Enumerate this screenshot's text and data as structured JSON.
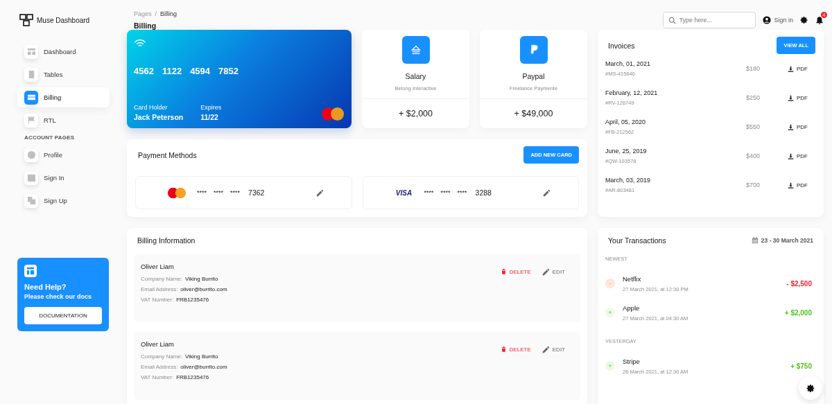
{
  "sidebar": {
    "brand": "Muse Dashboard",
    "items": [
      {
        "label": "Dashboard",
        "selected": false
      },
      {
        "label": "Tables",
        "selected": false
      },
      {
        "label": "Billing",
        "selected": true
      },
      {
        "label": "RTL",
        "selected": false
      }
    ],
    "section": "ACCOUNT PAGES",
    "account_items": [
      {
        "label": "Profile",
        "selected": false
      },
      {
        "label": "Sign In",
        "selected": false
      },
      {
        "label": "Sign Up",
        "selected": false
      }
    ],
    "help": {
      "title": "Need Help?",
      "subtitle": "Please check our docs",
      "button": "DOCUMENTATION"
    }
  },
  "header": {
    "breadcrumb": [
      "Pages",
      "Billing"
    ],
    "separator": "/",
    "title": "Billing",
    "search": {
      "placeholder": "Type here..."
    },
    "sign_in": "Sign in",
    "notifications": "4"
  },
  "credit_card": {
    "number": [
      "4562",
      "1122",
      "4594",
      "7852"
    ],
    "holder_label": "Card Holder",
    "holder": "Jack Peterson",
    "expires_label": "Expires",
    "expires": "11/22"
  },
  "income_cards": [
    {
      "kind": "salary",
      "title": "Salary",
      "subtitle": "Belong Interactive",
      "amount": "+ $2,000"
    },
    {
      "kind": "paypal",
      "title": "Paypal",
      "subtitle": "Freelance Paymente",
      "amount": "+ $49,000"
    }
  ],
  "payment_methods": {
    "title": "Payment Methods",
    "button": "ADD NEW CARD",
    "cards": [
      {
        "kind": "mastercard",
        "masked": [
          "****",
          "****",
          "****"
        ],
        "last4": "7362"
      },
      {
        "kind": "visa",
        "brand": "VISA",
        "masked": [
          "****",
          "****",
          "****"
        ],
        "last4": "3288"
      }
    ]
  },
  "invoices": {
    "title": "Invoices",
    "button": "VIEW ALL",
    "items": [
      {
        "date": "March, 01, 2021",
        "id": "#MS-415646",
        "amount": "$180",
        "action": "PDF"
      },
      {
        "date": "February, 12, 2021",
        "id": "#RV-126749",
        "amount": "$250",
        "action": "PDF"
      },
      {
        "date": "April, 05, 2020",
        "id": "#FB-212562",
        "amount": "$550",
        "action": "PDF"
      },
      {
        "date": "June, 25, 2019",
        "id": "#QW-103578",
        "amount": "$400",
        "action": "PDF"
      },
      {
        "date": "March, 03, 2019",
        "id": "#AR-803481",
        "amount": "$700",
        "action": "PDF"
      }
    ]
  },
  "billing": {
    "title": "Billing Information",
    "entries": [
      {
        "name": "Oliver Liam",
        "fields": [
          {
            "label": "Company Name:",
            "value": "Viking Burrito"
          },
          {
            "label": "Email Address:",
            "value": "oliver@burrito.com"
          },
          {
            "label": "VAT Number:",
            "value": "FRB1235476"
          }
        ],
        "delete": "DELETE",
        "edit": "EDIT"
      },
      {
        "name": "Oliver Liam",
        "fields": [
          {
            "label": "Company Name:",
            "value": "Viking Burrito"
          },
          {
            "label": "Email Address:",
            "value": "oliver@burrito.com"
          },
          {
            "label": "VAT Number:",
            "value": "FRB1235476"
          }
        ],
        "delete": "DELETE",
        "edit": "EDIT"
      }
    ]
  },
  "transactions": {
    "title": "Your Transactions",
    "date_range": "23 - 30 March 2021",
    "groups": [
      {
        "label": "NEWEST",
        "items": [
          {
            "kind": "debit",
            "sign": "-",
            "name": "Netflix",
            "time": "27 March 2021, at 12:30 PM",
            "amount": "- $2,500"
          },
          {
            "kind": "credit",
            "sign": "+",
            "name": "Apple",
            "time": "27 March 2021, at 04:30 AM",
            "amount": "+ $2,000"
          }
        ]
      },
      {
        "label": "YESTERDAY",
        "items": [
          {
            "kind": "credit",
            "sign": "+",
            "name": "Stripe",
            "time": "26 March 2021, at 12:30 AM",
            "amount": "+ $750"
          }
        ]
      }
    ]
  }
}
